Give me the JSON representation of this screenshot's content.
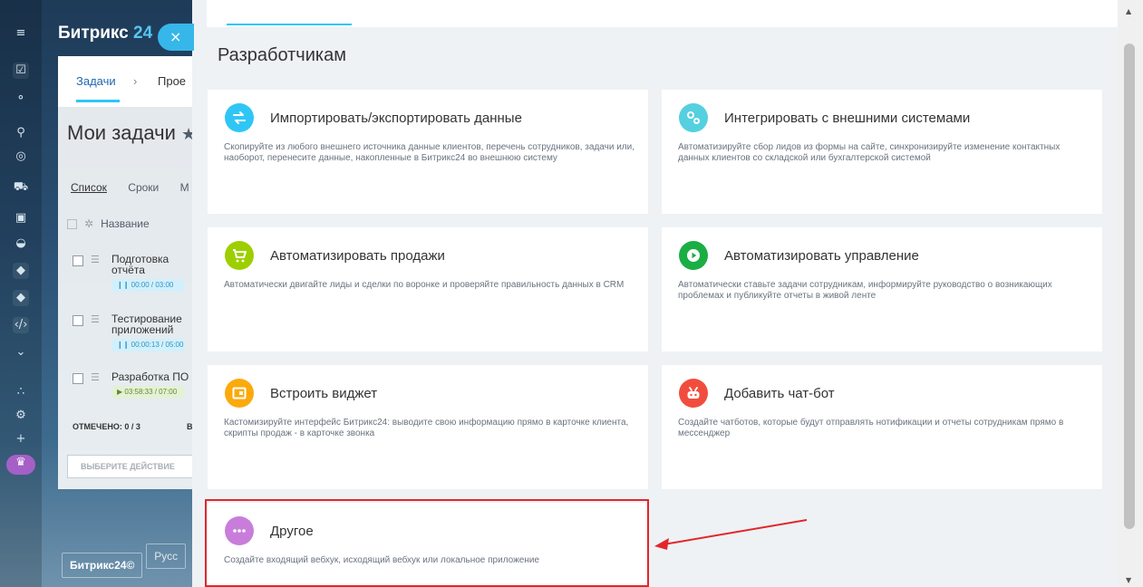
{
  "background": {
    "brand": {
      "name": "Битрикс",
      "suffix": "24"
    },
    "close_label": "×",
    "tabs": {
      "active": "Задачи",
      "chevron": "›",
      "next": "Прое"
    },
    "title": "Мои задачи",
    "title_star": "★",
    "view_tabs": [
      "Список",
      "Сроки",
      "М"
    ],
    "grid_header": "Название",
    "rows": [
      {
        "name": "Подготовка отчёта",
        "timer": "❙❙ 00:00 / 03:00",
        "running": false
      },
      {
        "name": "Тестирование приложений",
        "timer": "❙❙ 00:00:13 / 05:00",
        "running": false
      },
      {
        "name": "Разработка ПО",
        "timer": "▶ 03:58:33 / 07:00",
        "running": true
      }
    ],
    "marked": "ОТМЕЧЕНО: 0 / 3",
    "marked_rest": "В",
    "action_select": "ВЫБЕРИТЕ ДЕЙСТВИЕ",
    "footer": {
      "brand": "Битрикс24©",
      "lang": "Русс"
    }
  },
  "slider": {
    "section_title": "Разработчикам",
    "cards": [
      {
        "id": "import",
        "title": "Импортировать/экспортировать данные",
        "desc": "Скопируйте из любого внешнего источника данные клиентов, перечень сотрудников, задачи или, наоборот, перенесите данные, накопленные в Битрикс24 во внешнюю систему",
        "color": "#2fc6f6",
        "icon": "swap-arrows-icon"
      },
      {
        "id": "integrate",
        "title": "Интегрировать с внешними системами",
        "desc": "Автоматизируйте сбор лидов из формы на сайте, синхронизируйте изменение контактных данных клиентов со складской или бухгалтерской системой",
        "color": "#55d0e0",
        "icon": "gears-icon"
      },
      {
        "id": "sales",
        "title": "Автоматизировать продажи",
        "desc": "Автоматически двигайте лиды и сделки по воронке и проверяйте правильность данных в CRM",
        "color": "#9dcf00",
        "icon": "cart-icon"
      },
      {
        "id": "management",
        "title": "Автоматизировать управление",
        "desc": "Автоматически ставьте задачи сотрудникам, информируйте руководство о возникающих проблемах и публикуйте отчеты в живой ленте",
        "color": "#1bae44",
        "icon": "play-icon"
      },
      {
        "id": "widget",
        "title": "Встроить виджет",
        "desc": "Кастомизируйте интерфейс Битрикс24: выводите свою информацию прямо в карточке клиента, скрипты продаж - в карточке звонка",
        "color": "#fbaa0c",
        "icon": "widget-icon"
      },
      {
        "id": "chatbot",
        "title": "Добавить чат-бот",
        "desc": "Создайте чатботов, которые будут отправлять нотификации и отчеты сотрудникам прямо в мессенджер",
        "color": "#f14d3e",
        "icon": "robot-icon"
      },
      {
        "id": "other",
        "title": "Другое",
        "desc": "Создайте входящий вебхук, исходящий вебхук или локальное приложение",
        "color": "#c87ddb",
        "icon": "more-dots-icon"
      }
    ]
  },
  "colors": {
    "annotation_red": "#e3262b",
    "accent": "#2fc6f6"
  }
}
